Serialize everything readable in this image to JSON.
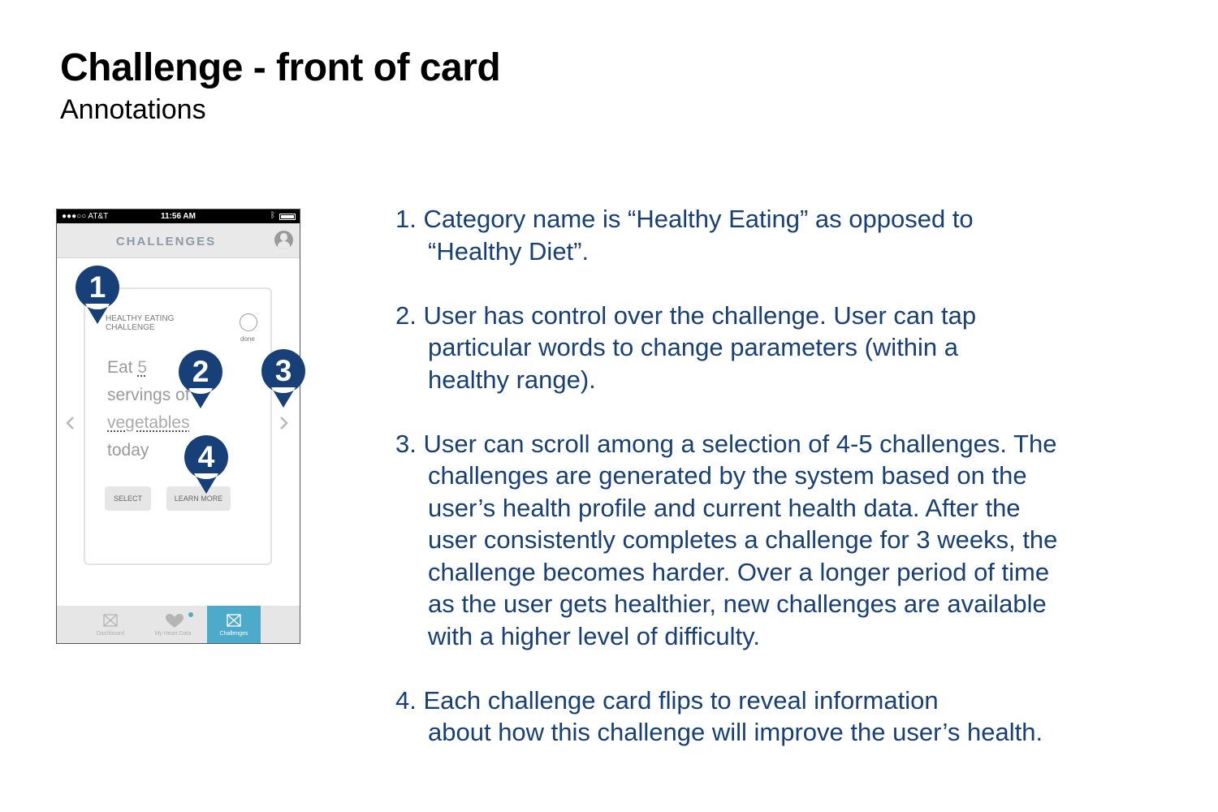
{
  "header": {
    "title": "Challenge - front of card",
    "subtitle": "Annotations"
  },
  "phone": {
    "status_bar": {
      "carrier": "●●●○○ AT&T",
      "time": "11:56 AM"
    },
    "nav_title": "CHALLENGES",
    "card": {
      "category_line1": "HEALTHY EATING",
      "category_line2": "CHALLENGE",
      "done_label": "done",
      "text": {
        "word_eat": "Eat ",
        "amount": "5",
        "word_servings": "servings of",
        "food": "vegetables",
        "word_today": "today"
      },
      "select_label": "SELECT",
      "learn_more_label": "LEARN MORE"
    },
    "tabs": [
      {
        "label": "Dashboard",
        "icon": "placeholder-box-icon"
      },
      {
        "label": "My Heart Data",
        "icon": "heart-icon"
      },
      {
        "label": "Challenges",
        "icon": "placeholder-box-icon",
        "active": true
      }
    ],
    "accent_color": "#4eaacb"
  },
  "markers": [
    "1",
    "2",
    "3",
    "4"
  ],
  "marker_color": "#173f78",
  "annotations": [
    {
      "line1": "1. Category name is “Healthy Eating” as opposed to",
      "rest": [
        "“Healthy Diet”."
      ]
    },
    {
      "line1": "2. User has control over the challenge. User can tap",
      "rest": [
        "particular words to change parameters (within a",
        "healthy range)."
      ]
    },
    {
      "line1": "3. User can scroll among a selection of 4-5 challenges. The",
      "rest": [
        "challenges are generated by the system based on the",
        "user’s health profile and current health data. After the",
        "user consistently completes a challenge for 3 weeks, the",
        "challenge becomes harder. Over a longer period of time",
        "as the user gets healthier, new challenges are available",
        "with a higher level of difficulty."
      ]
    },
    {
      "line1": "4. Each challenge card flips to reveal information",
      "rest": [
        "about how this challenge will improve the user’s health."
      ]
    }
  ],
  "annotation_color": "#173f78"
}
